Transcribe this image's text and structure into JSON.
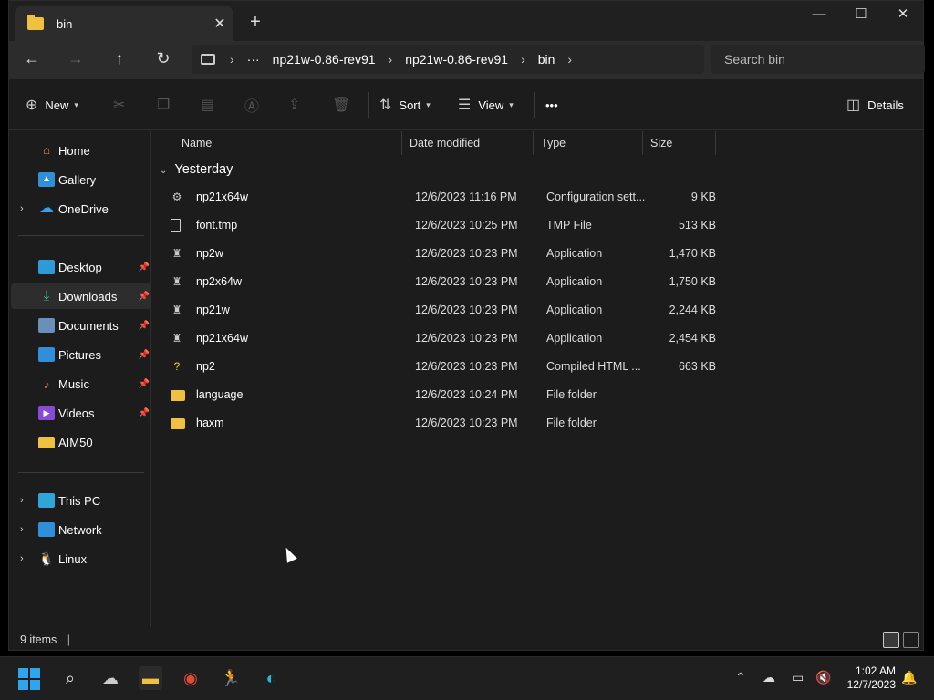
{
  "window": {
    "tab_title": "bin",
    "tab_close": "✕",
    "new_tab": "+",
    "minimize": "—",
    "maximize": "☐",
    "close": "✕"
  },
  "nav": {
    "back": "←",
    "forward": "→",
    "up": "↑",
    "refresh": "↻",
    "more": "···",
    "breadcrumbs": [
      "np21w-0.86-rev91",
      "np21w-0.86-rev91",
      "bin"
    ],
    "search_placeholder": "Search bin"
  },
  "toolbar": {
    "new_label": "New",
    "sort_label": "Sort",
    "view_label": "View",
    "more_label": "•••",
    "details_label": "Details"
  },
  "sidebar": {
    "items": [
      {
        "label": "Home",
        "icon": "home-icon"
      },
      {
        "label": "Gallery",
        "icon": "gallery-icon"
      },
      {
        "label": "OneDrive",
        "icon": "onedrive-icon"
      },
      {
        "label": "Desktop",
        "icon": "desktop-icon"
      },
      {
        "label": "Downloads",
        "icon": "downloads-icon"
      },
      {
        "label": "Documents",
        "icon": "documents-icon"
      },
      {
        "label": "Pictures",
        "icon": "pictures-icon"
      },
      {
        "label": "Music",
        "icon": "music-icon"
      },
      {
        "label": "Videos",
        "icon": "videos-icon"
      },
      {
        "label": "AIM50",
        "icon": "folder-icon"
      },
      {
        "label": "This PC",
        "icon": "pc-icon"
      },
      {
        "label": "Network",
        "icon": "network-icon"
      },
      {
        "label": "Linux",
        "icon": "linux-icon"
      }
    ]
  },
  "columns": {
    "name": "Name",
    "date": "Date modified",
    "type": "Type",
    "size": "Size"
  },
  "group_label": "Yesterday",
  "files": [
    {
      "name": "np21x64w",
      "date": "12/6/2023 11:16 PM",
      "type": "Configuration sett...",
      "size": "9 KB",
      "icon": "settings-file-icon"
    },
    {
      "name": "font.tmp",
      "date": "12/6/2023 10:25 PM",
      "type": "TMP File",
      "size": "513 KB",
      "icon": "file-icon"
    },
    {
      "name": "np2w",
      "date": "12/6/2023 10:23 PM",
      "type": "Application",
      "size": "1,470 KB",
      "icon": "app-icon"
    },
    {
      "name": "np2x64w",
      "date": "12/6/2023 10:23 PM",
      "type": "Application",
      "size": "1,750 KB",
      "icon": "app-icon"
    },
    {
      "name": "np21w",
      "date": "12/6/2023 10:23 PM",
      "type": "Application",
      "size": "2,244 KB",
      "icon": "app-icon"
    },
    {
      "name": "np21x64w",
      "date": "12/6/2023 10:23 PM",
      "type": "Application",
      "size": "2,454 KB",
      "icon": "app-icon"
    },
    {
      "name": "np2",
      "date": "12/6/2023 10:23 PM",
      "type": "Compiled HTML ...",
      "size": "663 KB",
      "icon": "help-file-icon"
    },
    {
      "name": "language",
      "date": "12/6/2023 10:24 PM",
      "type": "File folder",
      "size": "",
      "icon": "folder-icon"
    },
    {
      "name": "haxm",
      "date": "12/6/2023 10:23 PM",
      "type": "File folder",
      "size": "",
      "icon": "folder-icon"
    }
  ],
  "status": {
    "items_count": "9 items"
  },
  "taskbar": {
    "time": "1:02 AM",
    "date": "12/7/2023"
  }
}
